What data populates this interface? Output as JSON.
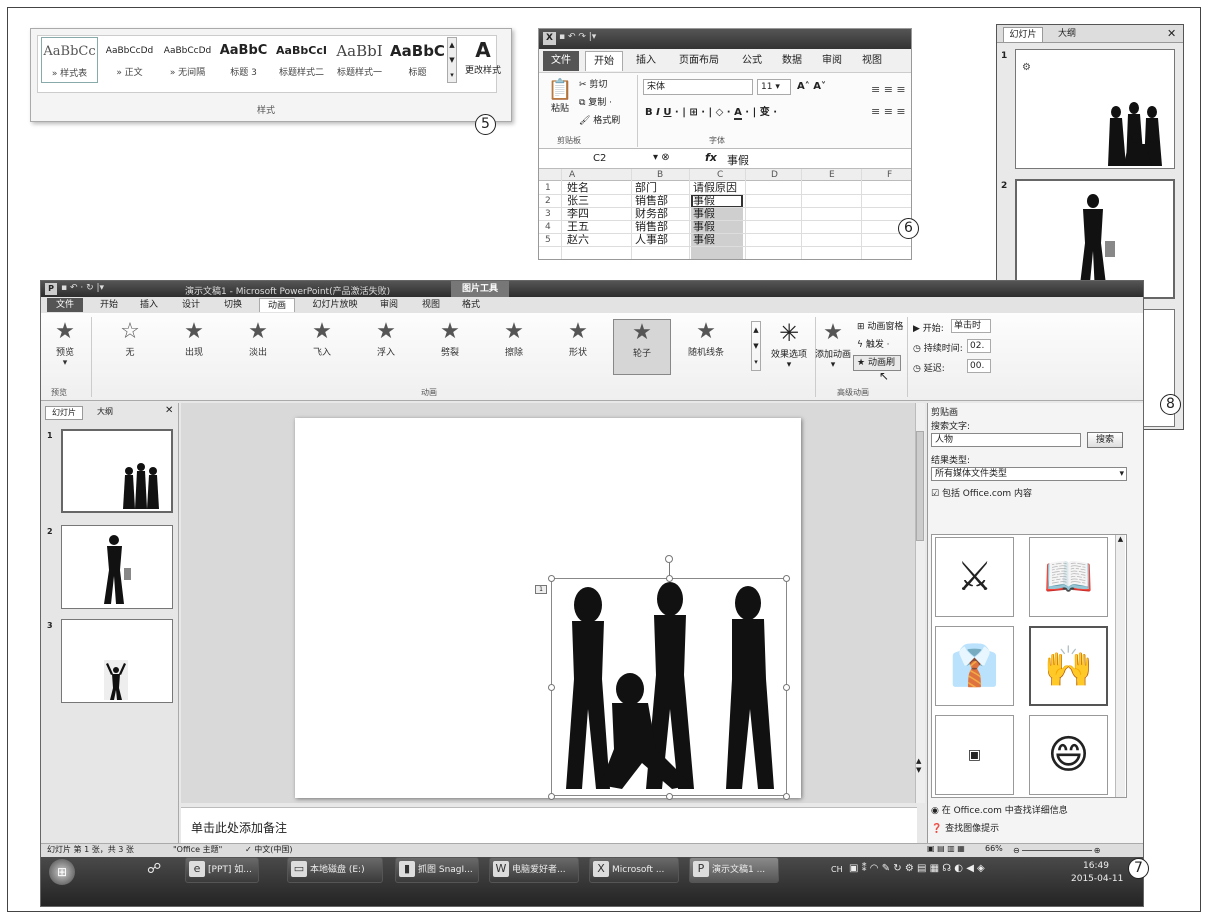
{
  "callouts": {
    "five": "5",
    "six": "6",
    "seven": "7",
    "eight": "8"
  },
  "word_styles": {
    "items": [
      {
        "sample": "AaBbCc",
        "label": "» 样式表"
      },
      {
        "sample": "AaBbCcDd",
        "label": "» 正文"
      },
      {
        "sample": "AaBbCcDd",
        "label": "» 无间隔"
      },
      {
        "sample": "AaBbC",
        "label": "标题 3"
      },
      {
        "sample": "AaBbCcI",
        "label": "标题样式二"
      },
      {
        "sample": "AaBbI",
        "label": "标题样式一"
      },
      {
        "sample": "AaBbC",
        "label": "标题"
      }
    ],
    "change_styles_label": "更改样式",
    "group_label": "样式"
  },
  "excel": {
    "tabs": [
      "文件",
      "开始",
      "插入",
      "页面布局",
      "公式",
      "数据",
      "审阅",
      "视图"
    ],
    "clipboard": {
      "paste": "粘贴",
      "cut": "剪切",
      "copy": "复制 ·",
      "format_painter": "格式刷",
      "group": "剪贴板"
    },
    "font": {
      "name": "宋体",
      "size": "11",
      "group": "字体"
    },
    "name_box": "C2",
    "formula": "事假",
    "columns": [
      "A",
      "B",
      "C",
      "D",
      "E",
      "F"
    ],
    "rows": [
      {
        "n": "1",
        "a": "姓名",
        "b": "部门",
        "c": "请假原因"
      },
      {
        "n": "2",
        "a": "张三",
        "b": "销售部",
        "c": "事假"
      },
      {
        "n": "3",
        "a": "李四",
        "b": "财务部",
        "c": "事假"
      },
      {
        "n": "4",
        "a": "王五",
        "b": "销售部",
        "c": "事假"
      },
      {
        "n": "5",
        "a": "赵六",
        "b": "人事部",
        "c": "事假"
      }
    ]
  },
  "slide_panel": {
    "tab_slides": "幻灯片",
    "tab_outline": "大纲",
    "close": "✕",
    "slides": [
      "1",
      "2",
      "3"
    ]
  },
  "ppt": {
    "title": "演示文稿1 - Microsoft PowerPoint(产品激活失败)",
    "context_tab": "图片工具",
    "tabs": [
      "文件",
      "开始",
      "插入",
      "设计",
      "切换",
      "动画",
      "幻灯片放映",
      "审阅",
      "视图",
      "格式"
    ],
    "preview": "预览",
    "preview_group": "预览",
    "animations": [
      "无",
      "出现",
      "淡出",
      "飞入",
      "浮入",
      "劈裂",
      "擦除",
      "形状",
      "轮子",
      "随机线条"
    ],
    "effect_options": "效果选项",
    "anim_group": "动画",
    "add_animation": "添加动画",
    "anim_pane": "动画窗格",
    "trigger": "触发 ·",
    "anim_painter": "动画刷",
    "adv_group": "高级动画",
    "start_label": "开始:",
    "start_value": "单击时",
    "duration_label": "持续时间:",
    "duration_value": "02.",
    "delay_label": "延迟:",
    "delay_value": "00.",
    "left_tabs": {
      "slides": "幻灯片",
      "outline": "大纲"
    },
    "notes": "单击此处添加备注",
    "status": {
      "slide_info": "幻灯片 第 1 张，共 3 张",
      "theme": "\"Office 主题\"",
      "lang": "中文(中国)",
      "zoom": "66%"
    },
    "clipart": {
      "title": "剪贴画",
      "search_label": "搜索文字:",
      "search_value": "人物",
      "search_btn": "搜索",
      "results_label": "结果类型:",
      "results_value": "所有媒体文件类型",
      "include": "包括 Office.com 内容",
      "link1": "在 Office.com 中查找详细信息",
      "link2": "查找图像提示"
    },
    "taskbar": {
      "items": [
        "[PPT] 如...",
        "本地磁盘 (E:)",
        "抓图 SnagI...",
        "电脑爱好者...",
        "Microsoft ...",
        "演示文稿1 ..."
      ],
      "tray": "CH",
      "time": "16:49",
      "date": "2015-04-11"
    }
  }
}
